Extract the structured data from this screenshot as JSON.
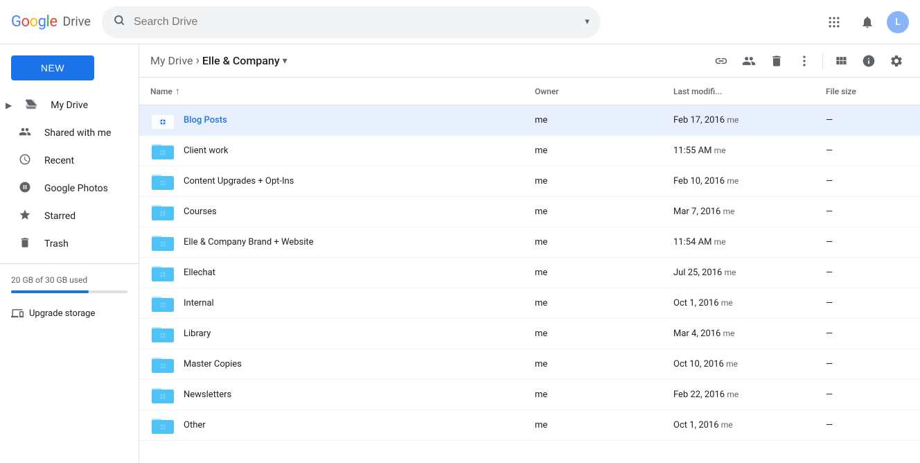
{
  "header": {
    "google_label": "Google",
    "drive_label": "Drive",
    "search_placeholder": "Search Drive",
    "apps_icon": "⋮⋮⋮",
    "notifications_icon": "🔔"
  },
  "sidebar": {
    "new_button": "NEW",
    "items": [
      {
        "id": "my-drive",
        "label": "My Drive",
        "icon": "drive",
        "active": false,
        "arrow": true
      },
      {
        "id": "shared",
        "label": "Shared with me",
        "icon": "people",
        "active": false
      },
      {
        "id": "recent",
        "label": "Recent",
        "icon": "clock",
        "active": false
      },
      {
        "id": "photos",
        "label": "Google Photos",
        "icon": "photos",
        "active": false
      },
      {
        "id": "starred",
        "label": "Starred",
        "icon": "star",
        "active": false
      },
      {
        "id": "trash",
        "label": "Trash",
        "icon": "trash",
        "active": false
      }
    ],
    "storage_text": "20 GB of 30 GB used",
    "upgrade_label": "Upgrade storage"
  },
  "breadcrumb": {
    "parent": "My Drive",
    "current": "Elle & Company",
    "separator": "›"
  },
  "toolbar": {
    "link_icon": "🔗",
    "person_icon": "👤",
    "delete_icon": "🗑",
    "more_icon": "⋮",
    "grid_icon": "⊞",
    "info_icon": "ⓘ",
    "settings_icon": "⚙"
  },
  "file_list": {
    "columns": {
      "name": "Name",
      "owner": "Owner",
      "modified": "Last modifi...",
      "size": "File size"
    },
    "files": [
      {
        "name": "Blog Posts",
        "owner": "me",
        "modified": "Feb 17, 2016",
        "modified_by": "me",
        "size": "—",
        "selected": true
      },
      {
        "name": "Client work",
        "owner": "me",
        "modified": "11:55 AM",
        "modified_by": "me",
        "size": "—",
        "selected": false
      },
      {
        "name": "Content Upgrades + Opt-Ins",
        "owner": "me",
        "modified": "Feb 10, 2016",
        "modified_by": "me",
        "size": "—",
        "selected": false
      },
      {
        "name": "Courses",
        "owner": "me",
        "modified": "Mar 7, 2016",
        "modified_by": "me",
        "size": "—",
        "selected": false
      },
      {
        "name": "Elle & Company Brand + Website",
        "owner": "me",
        "modified": "11:54 AM",
        "modified_by": "me",
        "size": "—",
        "selected": false
      },
      {
        "name": "Ellechat",
        "owner": "me",
        "modified": "Jul 25, 2016",
        "modified_by": "me",
        "size": "—",
        "selected": false
      },
      {
        "name": "Internal",
        "owner": "me",
        "modified": "Oct 1, 2016",
        "modified_by": "me",
        "size": "—",
        "selected": false
      },
      {
        "name": "Library",
        "owner": "me",
        "modified": "Mar 4, 2016",
        "modified_by": "me",
        "size": "—",
        "selected": false
      },
      {
        "name": "Master Copies",
        "owner": "me",
        "modified": "Oct 10, 2016",
        "modified_by": "me",
        "size": "—",
        "selected": false
      },
      {
        "name": "Newsletters",
        "owner": "me",
        "modified": "Feb 22, 2016",
        "modified_by": "me",
        "size": "—",
        "selected": false
      },
      {
        "name": "Other",
        "owner": "me",
        "modified": "Oct 1, 2016",
        "modified_by": "me",
        "size": "—",
        "selected": false
      }
    ]
  },
  "colors": {
    "selected_bg": "#1a73e8",
    "folder_color": "#4fc3f7",
    "new_btn_bg": "#1a73e8"
  }
}
